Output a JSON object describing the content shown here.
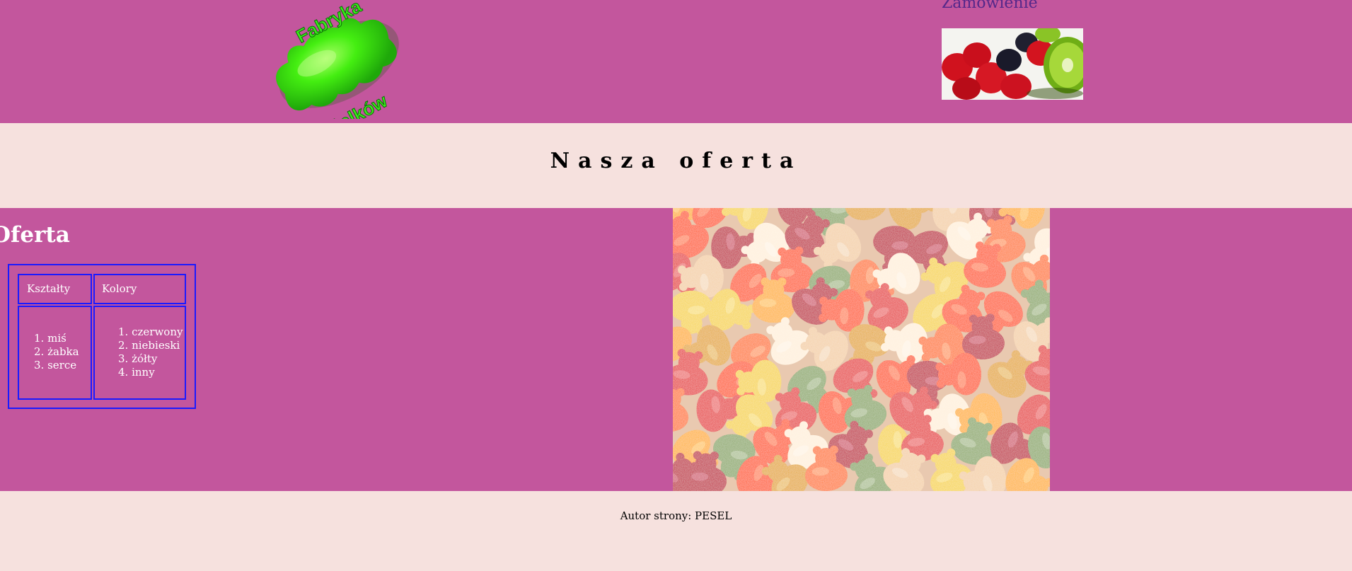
{
  "header": {
    "logo": {
      "line1": "Fabryka",
      "line2": "żelków",
      "icon": "gummy-bear-logo",
      "color": "#3bea1a"
    },
    "order_link": "Zamówienie",
    "fruit_image_icon": "fruit-jellies-image"
  },
  "banner": {
    "title": "Nasza oferta"
  },
  "main": {
    "heading": "Oferta",
    "table": {
      "headers": [
        "Kształty",
        "Kolory"
      ],
      "shapes": [
        "miś",
        "żabka",
        "serce"
      ],
      "colors": [
        "czerwony",
        "niebieski",
        "żółty",
        "inny"
      ]
    },
    "photo_icon": "gummy-candies-photo"
  },
  "footer": {
    "text": "Autor strony: PESEL"
  },
  "colors": {
    "header_bg": "#c3569d",
    "banner_bg": "#f6e1de",
    "table_border": "#1a1aff",
    "link": "#55288a"
  }
}
